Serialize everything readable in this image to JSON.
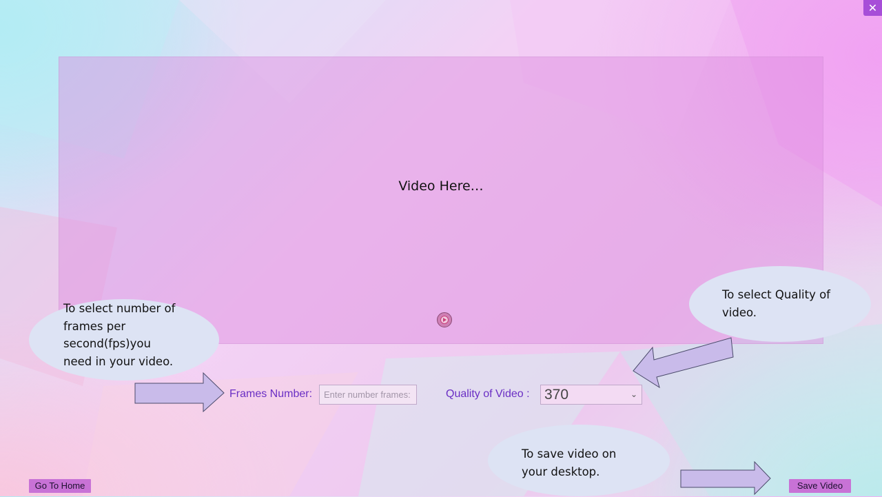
{
  "window": {
    "close_icon": "close-icon"
  },
  "video": {
    "placeholder": "Video Here…",
    "play_icon": "play-icon"
  },
  "callouts": {
    "fps_lines": [
      "To select number of",
      "frames per",
      "second(fps)you",
      "need in your video."
    ],
    "quality_lines": [
      "To select Quality of",
      "video."
    ],
    "save_lines": [
      "To save video on",
      "your desktop."
    ]
  },
  "controls": {
    "frames_label": "Frames Number:",
    "frames_placeholder": "Enter number frames:",
    "frames_value": "",
    "quality_label": "Quality of Video :",
    "quality_value": "370"
  },
  "buttons": {
    "home": "Go To Home",
    "save": "Save Video"
  },
  "colors": {
    "accent": "#a74ed8",
    "label_text": "#6a2fc4",
    "callout_bg": "#dde3f4",
    "arrow_fill": "#c9bbea",
    "button_bg": "#c872d6"
  }
}
